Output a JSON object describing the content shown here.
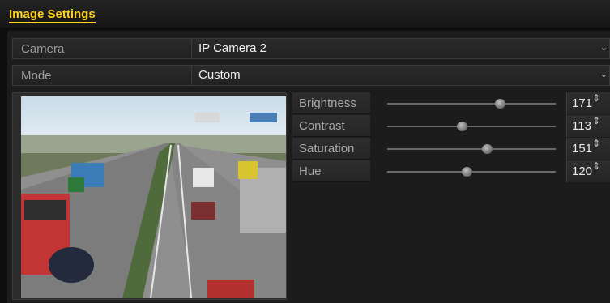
{
  "window": {
    "title": "Image Settings"
  },
  "camera": {
    "label": "Camera",
    "value": "IP Camera 2"
  },
  "mode": {
    "label": "Mode",
    "value": "Custom"
  },
  "adjustments": [
    {
      "label": "Brightness",
      "value": "171",
      "level": 171
    },
    {
      "label": "Contrast",
      "value": "113",
      "level": 113
    },
    {
      "label": "Saturation",
      "value": "151",
      "level": 151
    },
    {
      "label": "Hue",
      "value": "120",
      "level": 120
    }
  ],
  "icons": {
    "dropdown": "chevron-down-icon",
    "spinner": "spinner-updown-icon"
  },
  "colors": {
    "title_accent": "#ffd21e"
  }
}
